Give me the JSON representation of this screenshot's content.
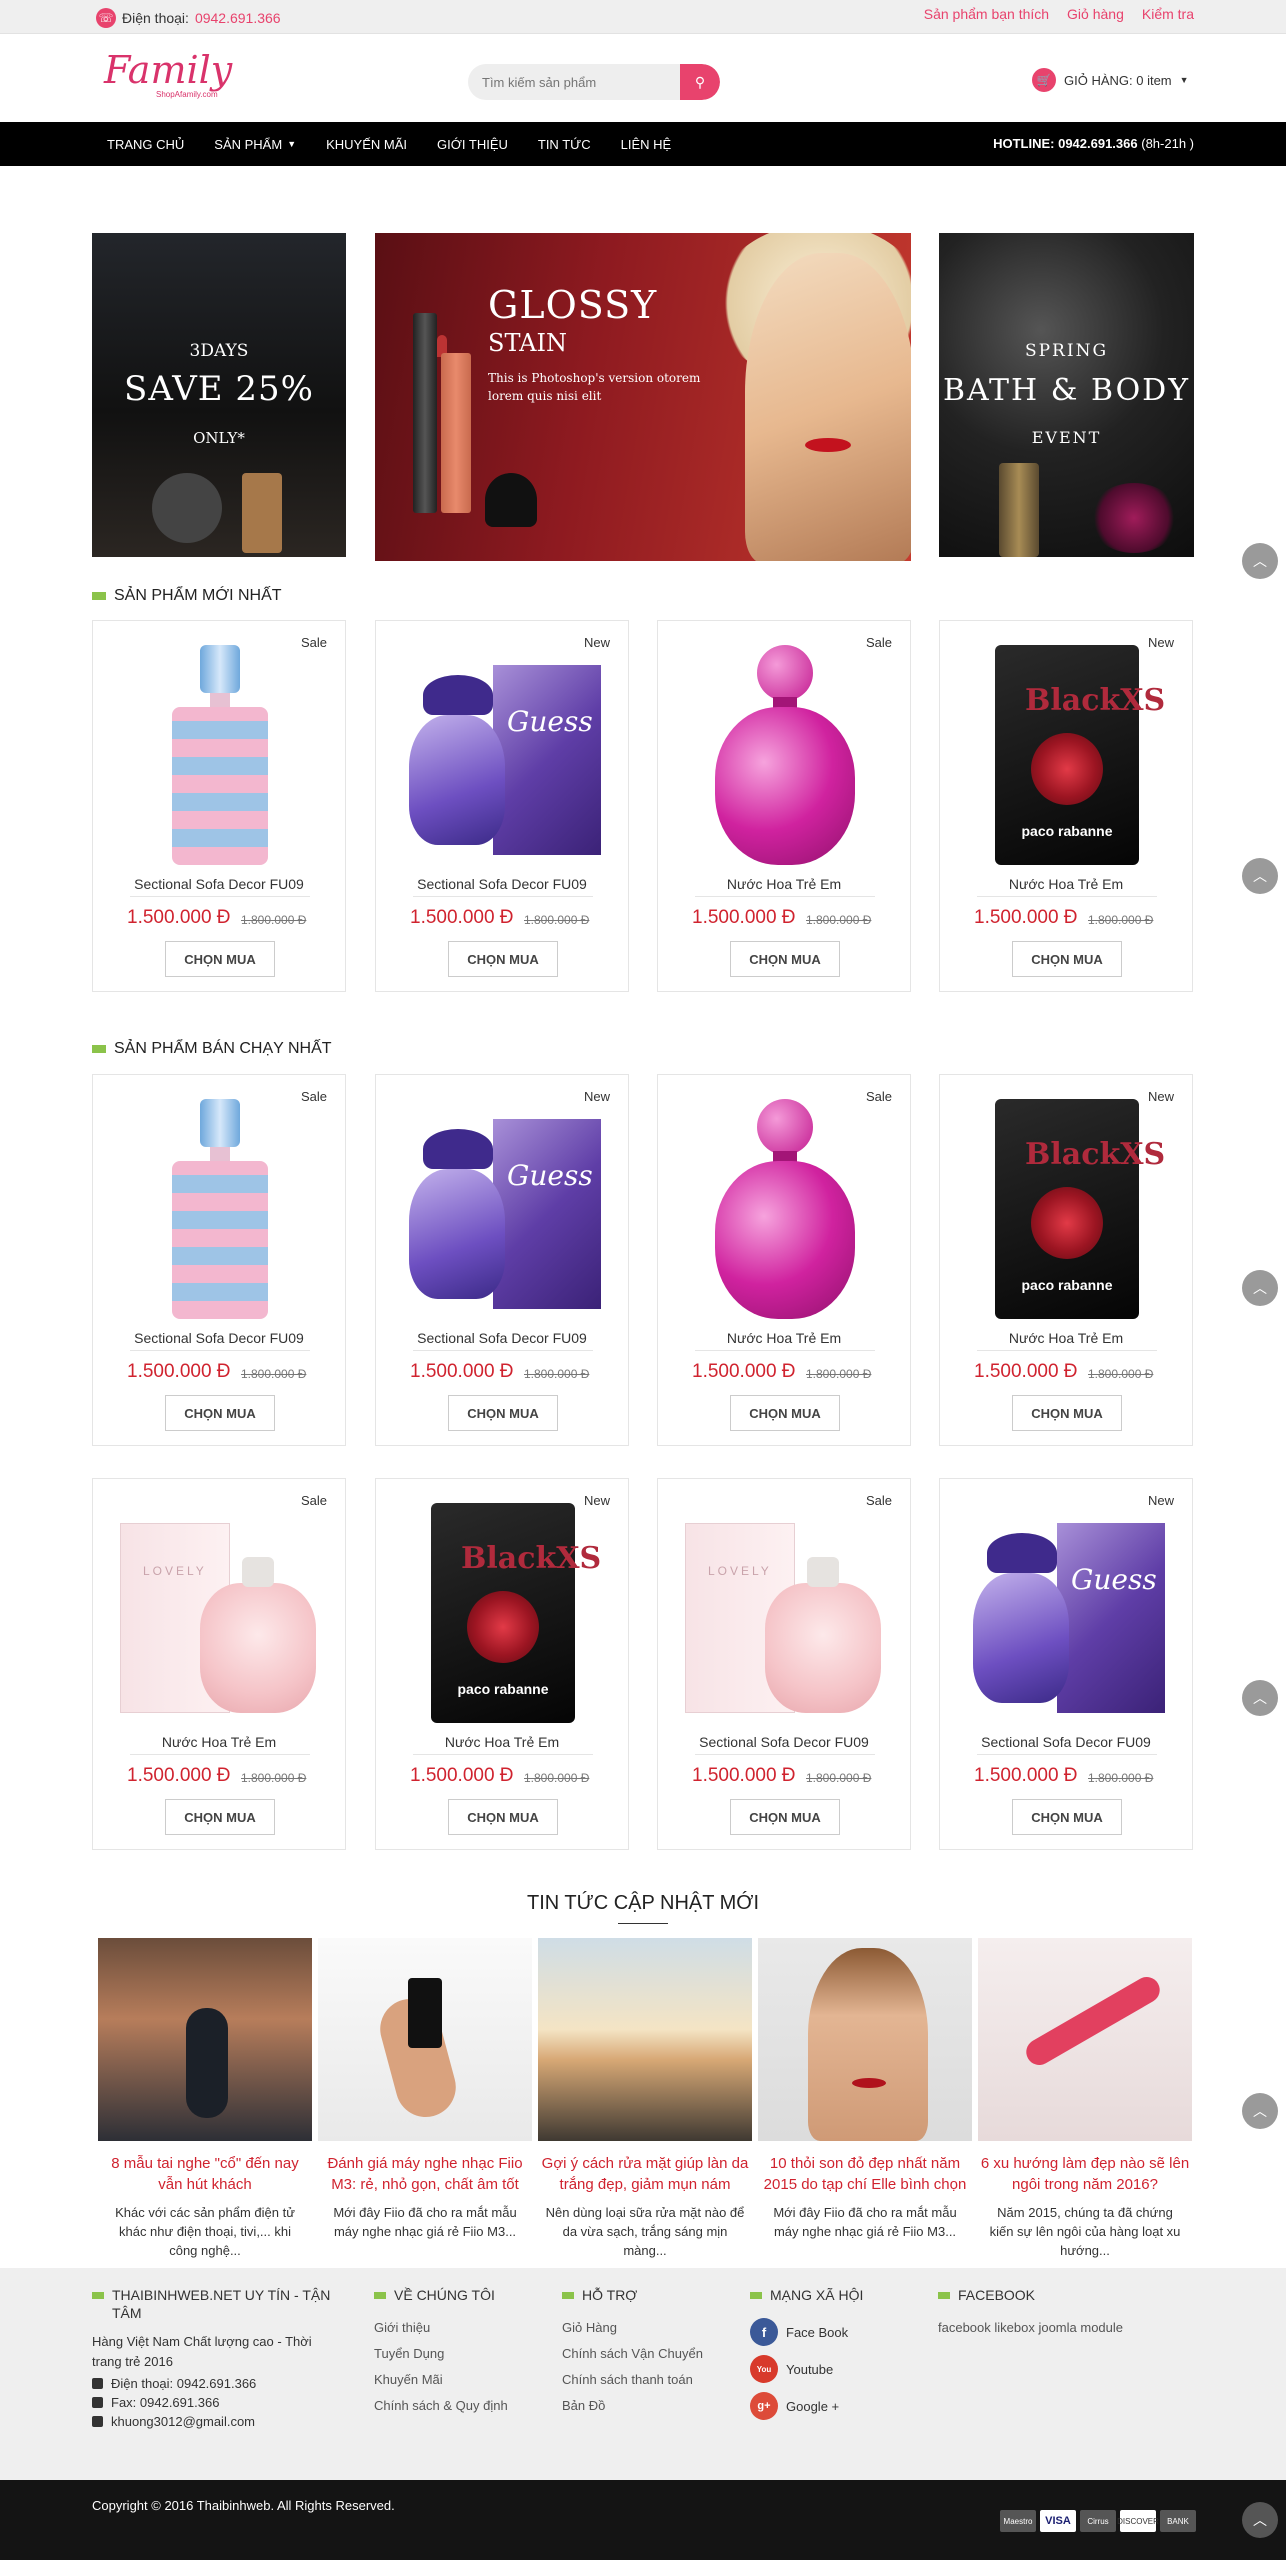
{
  "topbar": {
    "phone_label": "Điện thoại:",
    "phone_number": "0942.691.366",
    "links": [
      "Sản phẩm bạn thích",
      "Giỏ hàng",
      "Kiểm tra"
    ]
  },
  "header": {
    "logo_text": "Family",
    "logo_sub": "ShopAfamily.com",
    "search_placeholder": "Tìm kiếm sản phẩm",
    "cart_label": "GIỎ HÀNG: 0 item"
  },
  "nav": {
    "items": [
      "TRANG CHỦ",
      "SẢN PHẨM",
      "KHUYẾN MÃI",
      "GIỚI THIỆU",
      "TIN TỨC",
      "LIÊN HỆ"
    ],
    "hotline_label": "HOTLINE: 0942.691.366",
    "hotline_hours": "(8h-21h )"
  },
  "banners": {
    "left": {
      "line1": "3DAYS",
      "line2": "SAVE 25%",
      "line3": "ONLY*"
    },
    "center": {
      "line1": "GLOSSY",
      "line2": "STAIN",
      "line3": "This is Photoshop's version otorem lorem quis nisi elit"
    },
    "right": {
      "line1": "SPRING",
      "line2": "BATH & BODY",
      "line3": "EVENT"
    }
  },
  "sections": {
    "new_products": "SẢN PHẨM MỚI NHẤT",
    "best_sellers": "SẢN PHẨM BÁN CHẠY NHẤT",
    "news": "TIN TỨC CẬP NHẬT MỚI"
  },
  "products_new": [
    {
      "badge": "Sale",
      "name": "Sectional Sofa Decor FU09",
      "price": "1.500.000 Đ",
      "old_price": "1.800.000 Đ",
      "buy": "CHỌN MUA"
    },
    {
      "badge": "New",
      "name": "Sectional Sofa Decor FU09",
      "price": "1.500.000 Đ",
      "old_price": "1.800.000 Đ",
      "buy": "CHỌN MUA"
    },
    {
      "badge": "Sale",
      "name": "Nước Hoa Trẻ Em",
      "price": "1.500.000 Đ",
      "old_price": "1.800.000 Đ",
      "buy": "CHỌN MUA"
    },
    {
      "badge": "New",
      "name": "Nước Hoa Trẻ Em",
      "price": "1.500.000 Đ",
      "old_price": "1.800.000 Đ",
      "buy": "CHỌN MUA"
    }
  ],
  "products_best_1": [
    {
      "badge": "Sale",
      "name": "Sectional Sofa Decor FU09",
      "price": "1.500.000 Đ",
      "old_price": "1.800.000 Đ",
      "buy": "CHỌN MUA"
    },
    {
      "badge": "New",
      "name": "Sectional Sofa Decor FU09",
      "price": "1.500.000 Đ",
      "old_price": "1.800.000 Đ",
      "buy": "CHỌN MUA"
    },
    {
      "badge": "Sale",
      "name": "Nước Hoa Trẻ Em",
      "price": "1.500.000 Đ",
      "old_price": "1.800.000 Đ",
      "buy": "CHỌN MUA"
    },
    {
      "badge": "New",
      "name": "Nước Hoa Trẻ Em",
      "price": "1.500.000 Đ",
      "old_price": "1.800.000 Đ",
      "buy": "CHỌN MUA"
    }
  ],
  "products_best_2": [
    {
      "badge": "Sale",
      "name": "Nước Hoa Trẻ Em",
      "price": "1.500.000 Đ",
      "old_price": "1.800.000 Đ",
      "buy": "CHỌN MUA"
    },
    {
      "badge": "New",
      "name": "Nước Hoa Trẻ Em",
      "price": "1.500.000 Đ",
      "old_price": "1.800.000 Đ",
      "buy": "CHỌN MUA"
    },
    {
      "badge": "Sale",
      "name": "Sectional Sofa Decor FU09",
      "price": "1.500.000 Đ",
      "old_price": "1.800.000 Đ",
      "buy": "CHỌN MUA"
    },
    {
      "badge": "New",
      "name": "Sectional Sofa Decor FU09",
      "price": "1.500.000 Đ",
      "old_price": "1.800.000 Đ",
      "buy": "CHỌN MUA"
    }
  ],
  "news": [
    {
      "title": "8 mẫu tai nghe \"cổ\" đến nay vẫn hút khách",
      "desc": "Khác với các sản phẩm điện tử khác như điện thoại, tivi,... khi công nghệ..."
    },
    {
      "title": "Đánh giá máy nghe nhạc Fiio M3: rẻ, nhỏ gọn, chất âm tốt",
      "desc": "Mới đây Fiio đã cho ra mắt mẫu máy nghe nhạc giá rẻ Fiio M3..."
    },
    {
      "title": "Gợi ý cách rửa mặt giúp làn da trắng đẹp, giảm mụn nám",
      "desc": "Nên dùng loại sữa rửa mặt nào để da vừa sạch, trắng sáng mịn màng..."
    },
    {
      "title": "10 thỏi son đỏ đẹp nhất năm 2015 do tạp chí Elle bình chọn",
      "desc": "Mới đây Fiio đã cho ra mắt mẫu máy nghe nhạc giá rẻ Fiio M3..."
    },
    {
      "title": "6 xu hướng làm đẹp nào sẽ lên ngôi trong năm 2016?",
      "desc": "Năm 2015, chúng ta đã chứng kiến sự lên ngôi của hàng loạt xu hướng..."
    }
  ],
  "footer": {
    "col1": {
      "title": "THAIBINHWEB.NET UY TÍN - TẬN TÂM",
      "intro": "Hàng Việt Nam Chất lượng cao - Thời trang trẻ 2016",
      "phone": "Điện thoại: 0942.691.366",
      "fax": "Fax: 0942.691.366",
      "email": "khuong3012@gmail.com"
    },
    "col2": {
      "title": "VỀ CHÚNG TÔI",
      "links": [
        "Giới thiệu",
        "Tuyển Dụng",
        "Khuyến Mãi",
        "Chính sách & Quy định"
      ]
    },
    "col3": {
      "title": "HỖ TRỢ",
      "links": [
        "Giỏ Hàng",
        "Chính sách Vận Chuyển",
        "Chính sách thanh toán",
        "Bản Đồ"
      ]
    },
    "col4": {
      "title": "MẠNG XÃ HỘI",
      "links": [
        "Face Book",
        "Youtube",
        "Google +"
      ]
    },
    "col5": {
      "title": "FACEBOOK",
      "text": "facebook likebox joomla module"
    }
  },
  "bottom": {
    "copyright": "Copyright © 2016 Thaibinhweb. All Rights Reserved.",
    "payments": [
      "Maestro",
      "VISA",
      "Cirrus",
      "DISCOVER",
      "BANK"
    ]
  },
  "colors": {
    "accent": "#e8436d",
    "price": "#d0232f",
    "section_bar": "#8bc34a"
  }
}
